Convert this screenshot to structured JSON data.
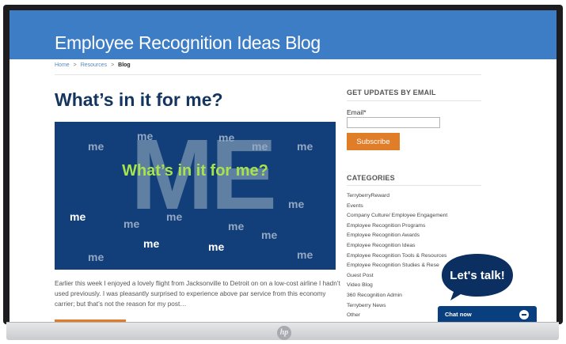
{
  "site": {
    "title": "Employee Recognition Ideas Blog"
  },
  "breadcrumb": {
    "home": "Home",
    "sep1": ">",
    "resources": "Resources",
    "sep2": ">",
    "current": "Blog"
  },
  "post": {
    "title": "What’s in it for me?",
    "image": {
      "title": "What’s in it for me?",
      "big_text": "ME",
      "word": "me"
    },
    "excerpt": "Earlier this week I enjoyed a lovely flight from Jacksonville to Detroit on on a low-cost airline I hadn’t used previously.  I was pleasantly surprised to experience above par service from this economy carrier; but that’s not the reason for my post…"
  },
  "sidebar": {
    "updates_heading": "GET UPDATES BY EMAIL",
    "email_label": "Email*",
    "email_value": "",
    "subscribe_label": "Subscribe",
    "categories_heading": "CATEGORIES",
    "categories": [
      "TerryberryReward",
      "Events",
      "Company Culture/ Employee Engagement",
      "Employee Recognition Programs",
      "Employee Recognition Awards",
      "Employee Recognition Ideas",
      "Employee Recognition Tools & Resources",
      "Employee Recognition Studies & Rese",
      "Guest Post",
      "Video Blog",
      "360 Recognition Admin",
      "Terryberry News",
      "Other"
    ]
  },
  "chat": {
    "bubble": "Let's talk!",
    "bar_label": "Chat now"
  },
  "colors": {
    "header": "#3c7dc5",
    "title_navy": "#14355e",
    "orange": "#e07d28",
    "hero_bg": "#123f79",
    "hero_green": "#a7e34c",
    "chat_navy": "#0a3f7f"
  },
  "icons": {
    "chat": "chat-bubble-icon",
    "monitor_brand": "hp-logo"
  }
}
